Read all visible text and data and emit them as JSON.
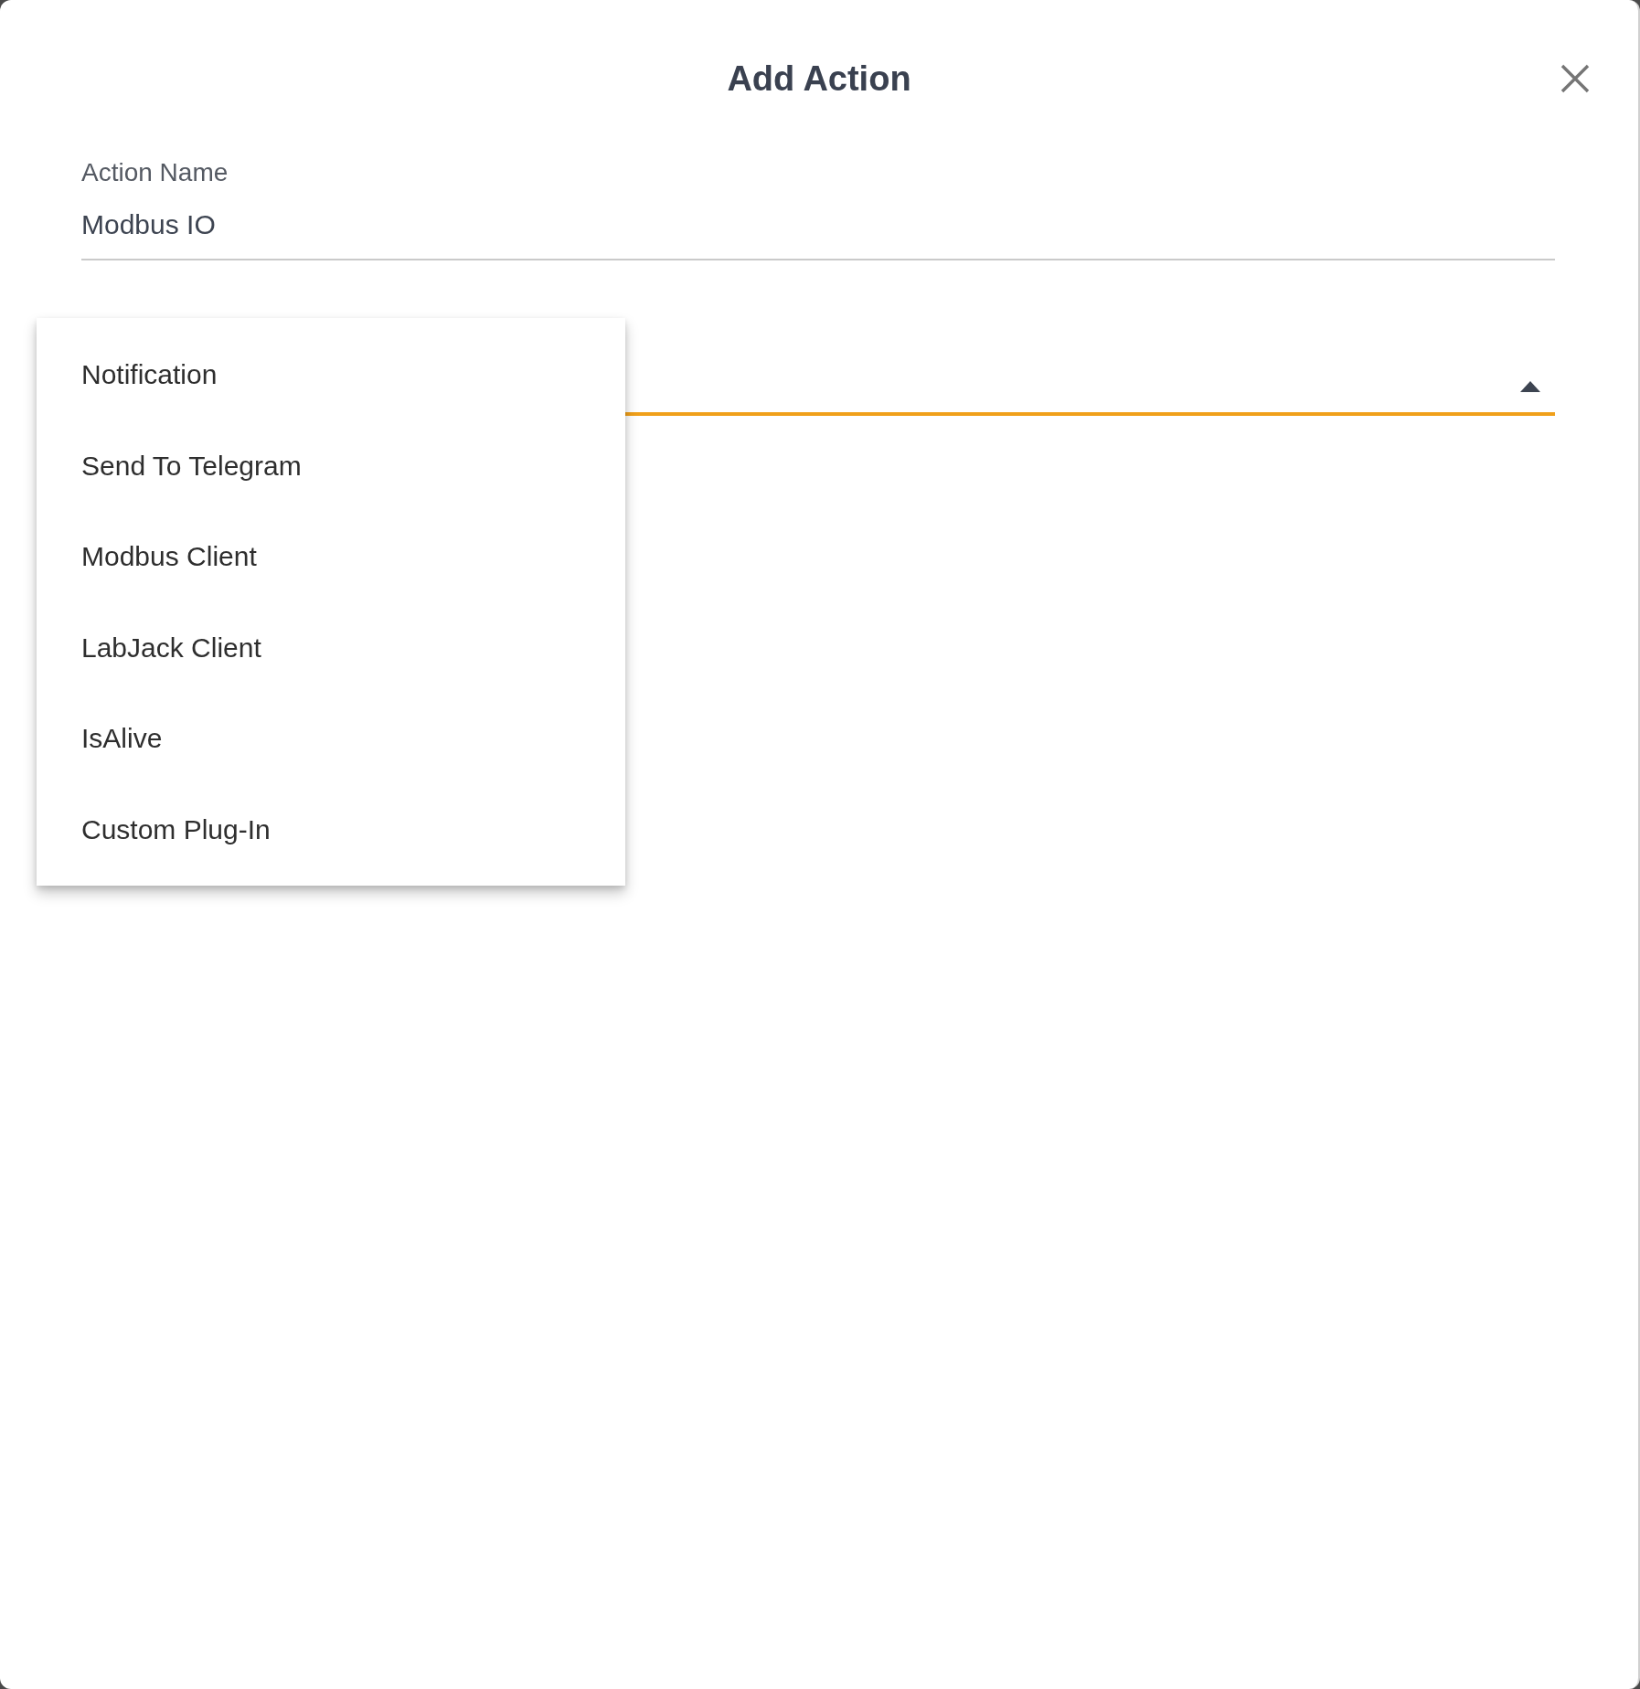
{
  "dialog": {
    "title": "Add Action"
  },
  "fields": [
    {
      "label": "Action Name",
      "value": "Modbus IO"
    }
  ],
  "select": {
    "focused": true,
    "expanded": true,
    "options": [
      {
        "label": "Notification",
        "selected": false
      },
      {
        "label": "Send To Telegram",
        "selected": false
      },
      {
        "label": "Modbus Client",
        "selected": false
      },
      {
        "label": "LabJack Client",
        "selected": false
      },
      {
        "label": "IsAlive",
        "selected": false
      },
      {
        "label": "Custom Plug-In",
        "selected": false
      }
    ]
  }
}
